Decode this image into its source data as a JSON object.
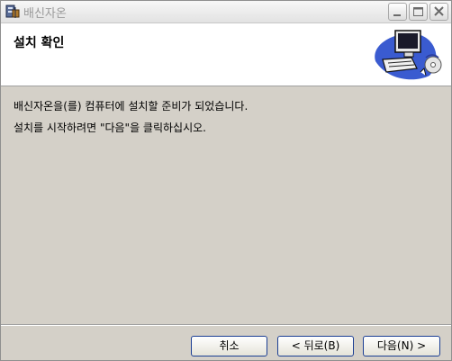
{
  "window": {
    "title": "배신자온",
    "controls": {
      "minimize_icon": "minimize-icon",
      "maximize_icon": "maximize-icon",
      "close_icon": "close-icon"
    }
  },
  "header": {
    "title": "설치 확인",
    "art_icon": "computer-install-icon"
  },
  "body": {
    "line1": "배신자온을(를) 컴퓨터에 설치할 준비가 되었습니다.",
    "line2": "설치를 시작하려면 \"다음\"을 클릭하십시오."
  },
  "buttons": {
    "cancel": "취소",
    "back": "< 뒤로(B)",
    "next": "다음(N) >"
  },
  "colors": {
    "header_bg": "#ffffff",
    "body_bg": "#d4d0c8",
    "button_border": "#1c3f94"
  }
}
